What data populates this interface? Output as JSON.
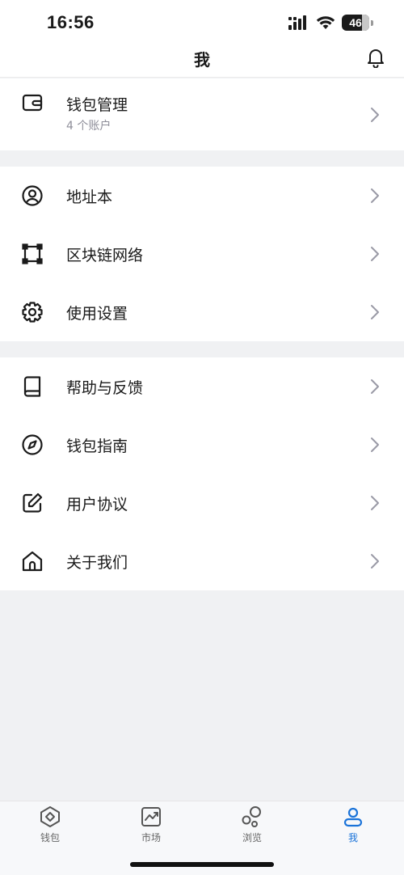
{
  "status": {
    "time": "16:56",
    "battery": "46"
  },
  "header": {
    "title": "我"
  },
  "wallet": {
    "label": "钱包管理",
    "sub": "4 个账户"
  },
  "group2": {
    "address_book": "地址本",
    "network": "区块链网络",
    "settings": "使用设置"
  },
  "group3": {
    "help": "帮助与反馈",
    "guide": "钱包指南",
    "agreement": "用户协议",
    "about": "关于我们"
  },
  "tabs": {
    "wallet": "钱包",
    "market": "市场",
    "browse": "浏览",
    "me": "我"
  },
  "colors": {
    "accent": "#1a73d9",
    "separator": "#f0f1f3",
    "chevron": "#9a9aa6"
  }
}
